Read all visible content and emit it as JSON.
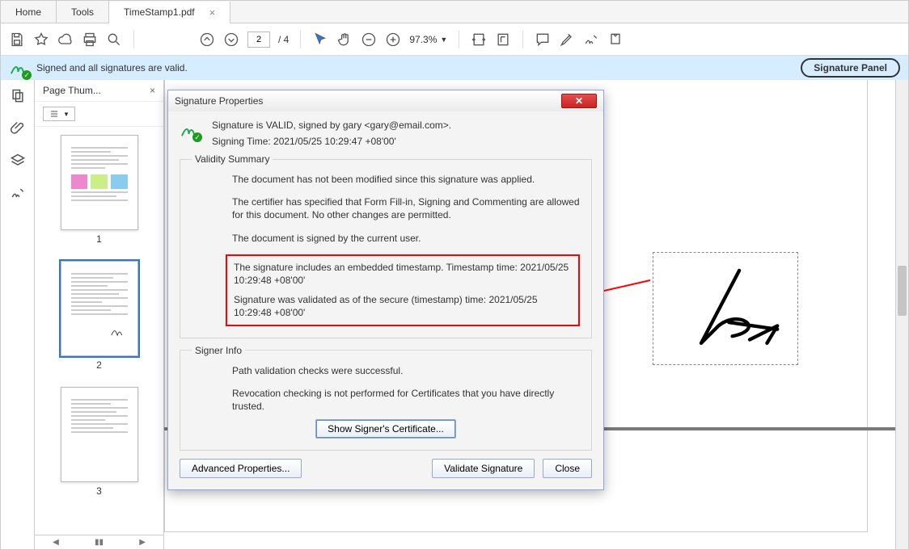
{
  "tabs": {
    "home": "Home",
    "tools": "Tools",
    "doc": "TimeStamp1.pdf"
  },
  "pagebox": {
    "current": "2",
    "total": "4"
  },
  "zoom": {
    "pct": "97.3%"
  },
  "sigbar": {
    "msg": "Signed and all signatures are valid.",
    "panel": "Signature Panel"
  },
  "thumbs": {
    "title": "Page Thum...",
    "p1": "1",
    "p2": "2",
    "p3": "3"
  },
  "dialog": {
    "title": "Signature Properties",
    "valid_line": "Signature is VALID, signed by gary <gary@email.com>.",
    "signing_time": "Signing Time:  2021/05/25 10:29:47 +08'00'",
    "validity_legend": "Validity Summary",
    "v1": "The document has not been modified since this signature was applied.",
    "v2": "The certifier has specified that Form Fill-in, Signing and Commenting are allowed for this document. No other changes are permitted.",
    "v3": "The document is signed by the current user.",
    "ts1": "The signature includes an embedded timestamp. Timestamp time: 2021/05/25 10:29:48 +08'00'",
    "ts2": "Signature was validated as of the secure (timestamp) time: 2021/05/25 10:29:48 +08'00'",
    "signer_legend": "Signer Info",
    "s1": "Path validation checks were successful.",
    "s2": "Revocation checking is not performed for Certificates that you have directly trusted.",
    "cert_btn": "Show Signer's Certificate...",
    "adv_btn": "Advanced Properties...",
    "validate_btn": "Validate Signature",
    "close_btn": "Close"
  }
}
